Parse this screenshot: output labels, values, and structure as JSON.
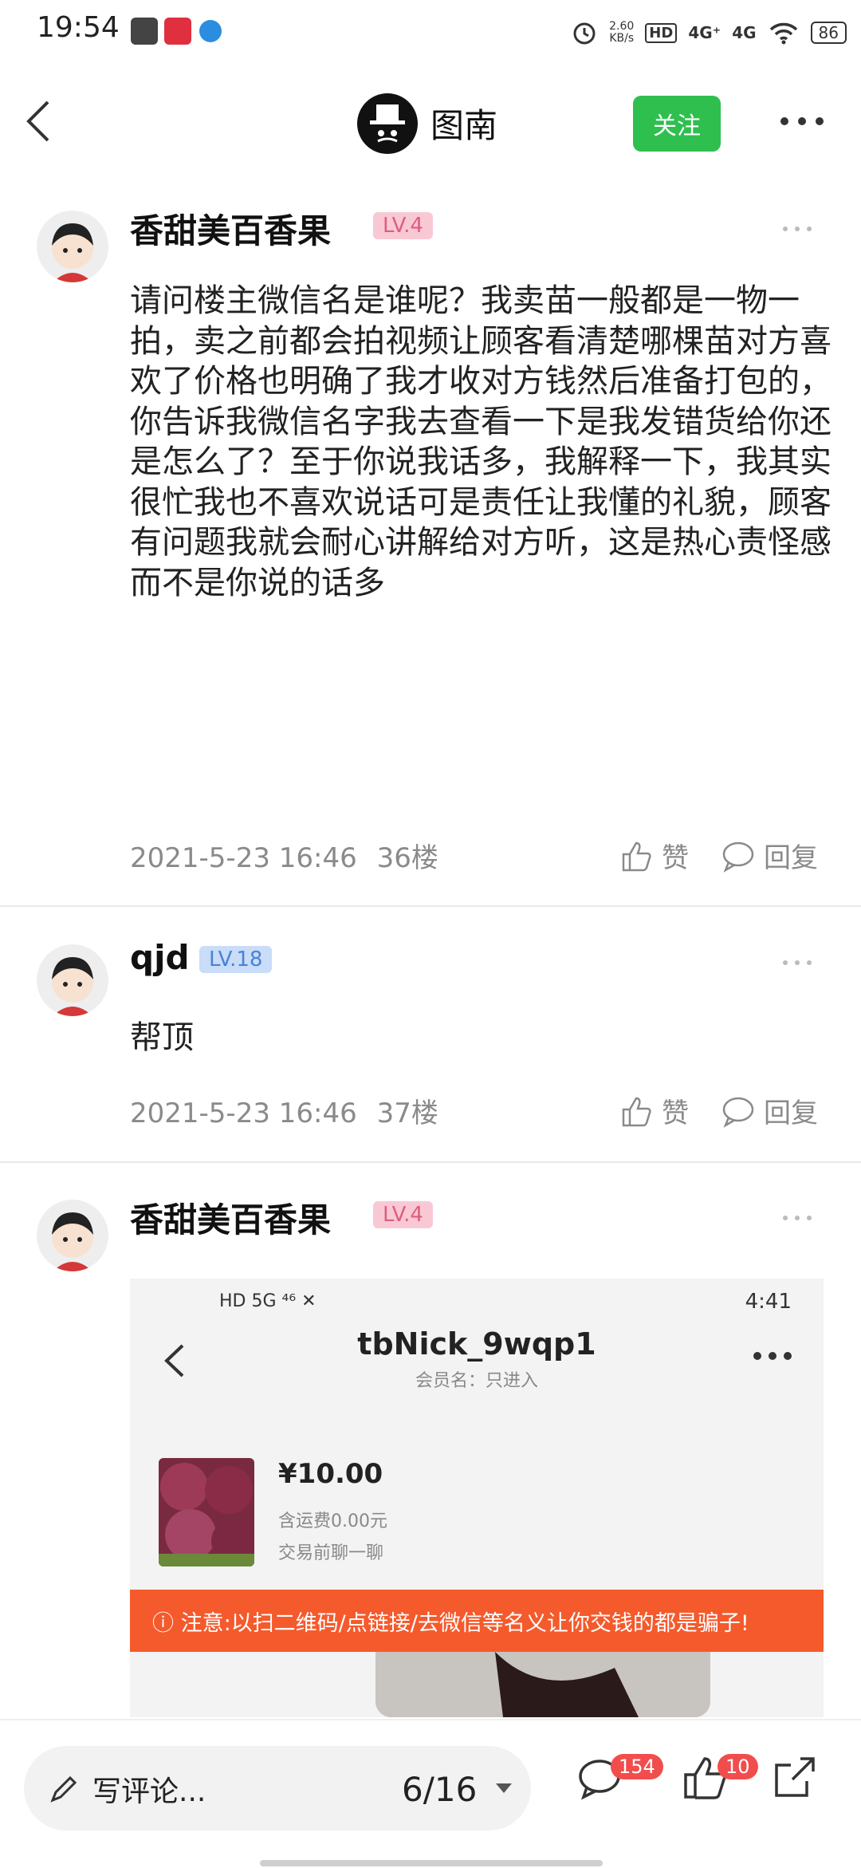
{
  "status_bar": {
    "time": "19:54",
    "speed_value": "2.60",
    "speed_unit": "KB/s",
    "hd": "HD",
    "signal1": "4G⁺",
    "signal2": "4G",
    "battery": "86"
  },
  "header": {
    "title": "图南",
    "follow_label": "关注"
  },
  "posts": [
    {
      "username": "香甜美百香果",
      "level": "LV.4",
      "content": "请问楼主微信名是谁呢？我卖苗一般都是一物一拍，卖之前都会拍视频让顾客看清楚哪棵苗对方喜欢了价格也明确了我才收对方钱然后准备打包的，你告诉我微信名字我去查看一下是我发错货给你还是怎么了？至于你说我话多，我解释一下，我其实很忙我也不喜欢说话可是责任让我懂的礼貌，顾客有问题我就会耐心讲解给对方听，这是热心责怪感而不是你说的话多",
      "datetime": "2021-5-23 16:46",
      "floor": "36楼",
      "like_label": "赞",
      "reply_label": "回复"
    },
    {
      "username": "qjd",
      "level": "LV.18",
      "content": "帮顶",
      "datetime": "2021-5-23 16:46",
      "floor": "37楼",
      "like_label": "赞",
      "reply_label": "回复"
    },
    {
      "username": "香甜美百香果",
      "level": "LV.4"
    }
  ],
  "embedded": {
    "status_left": "HD 5G ⁴⁶ ✕",
    "time": "4:41",
    "title": "tbNick_9wqp1",
    "subtitle": "会员名：只进入",
    "price": "¥10.00",
    "shipping": "含运费0.00元",
    "chat": "交易前聊一聊",
    "warning": "ⓘ 注意:以扫二维码/点链接/去微信等名义让你交钱的都是骗子!"
  },
  "bottom_bar": {
    "comment_placeholder": "写评论...",
    "page_indicator": "6/16",
    "comment_count": "154",
    "like_count": "10"
  }
}
